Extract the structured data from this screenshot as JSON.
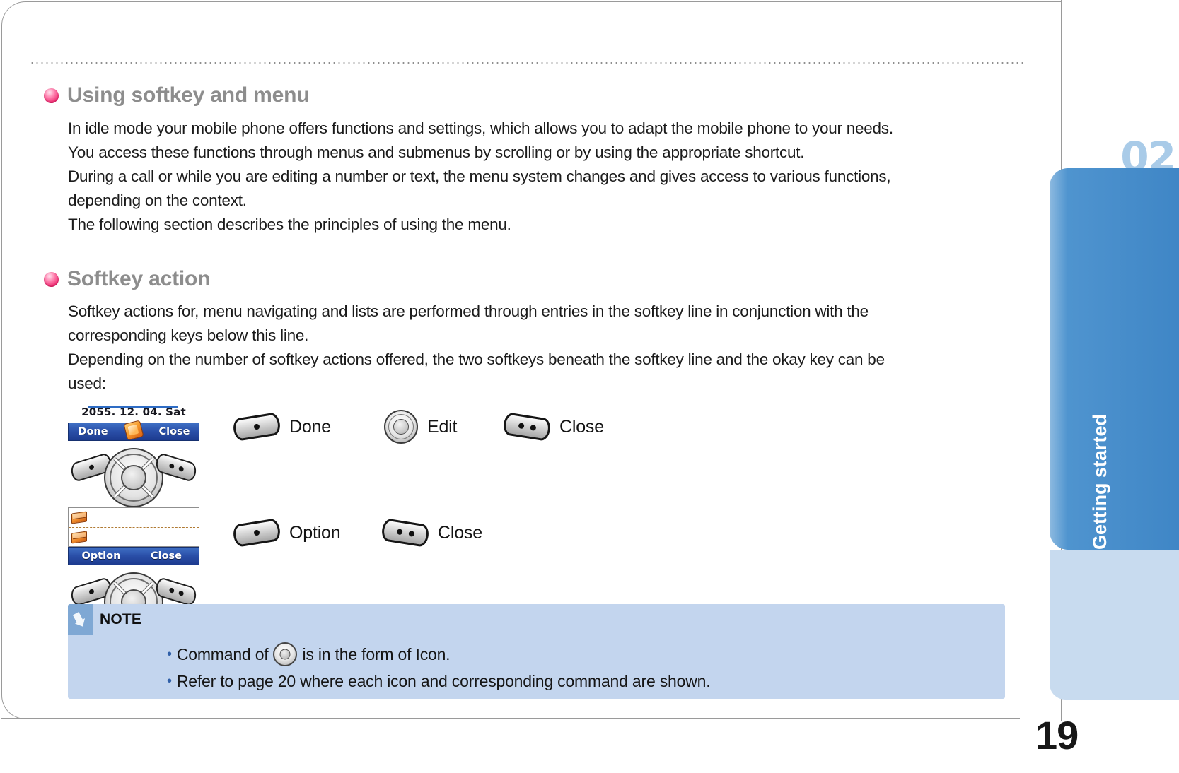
{
  "sections": [
    {
      "heading": "Using softkey and menu",
      "paragraphs": [
        "In idle mode your mobile phone offers functions and settings, which allows you to adapt the mobile phone to your needs.",
        "You access these functions through menus and submenus by scrolling or by using the appropriate shortcut.",
        "During a call or while you are editing a number or text, the menu system changes and gives access to various functions,",
        "depending on the context.",
        "The following section describes the principles of using the menu."
      ]
    },
    {
      "heading": "Softkey action",
      "paragraphs": [
        "Softkey actions for, menu navigating and lists are performed through entries in the softkey line in conjunction with the",
        "corresponding keys below this line.",
        "Depending on the number of softkey actions offered, the two softkeys beneath the softkey line and the okay key can be",
        "used:"
      ]
    }
  ],
  "mockups": [
    {
      "name": "idle-screen-mockup",
      "date_text": "2055. 12. 04. Sat",
      "softkey_left": "Done",
      "softkey_center_icon": "pencil-icon",
      "softkey_right": "Close"
    },
    {
      "name": "list-screen-mockup",
      "list_icons": [
        "envelope-icon",
        "envelope-icon"
      ],
      "softkey_left": "Option",
      "softkey_right": "Close"
    }
  ],
  "legend_row_1": [
    {
      "key_icon": "left-softkey-icon",
      "label": "Done"
    },
    {
      "key_icon": "okay-key-icon",
      "label": "Edit"
    },
    {
      "key_icon": "right-softkey-icon",
      "label": "Close"
    }
  ],
  "legend_row_2": [
    {
      "key_icon": "left-softkey-icon",
      "label": "Option"
    },
    {
      "key_icon": "right-softkey-icon",
      "label": "Close"
    }
  ],
  "note": {
    "title": "NOTE",
    "icon": "note-arrow-icon",
    "line1_before": "Command of",
    "line1_icon": "okay-key-icon",
    "line1_after": "is in the form of Icon.",
    "line2": "Refer to page 20 where each icon and corresponding command are shown."
  },
  "chapter": {
    "number": "02",
    "label": "Getting started"
  },
  "page_number": "19",
  "colors": {
    "accent_pink": "#ef2f74",
    "heading_grey": "#8d8d8d",
    "tab_blue": "#3f86c6",
    "note_bg": "#c3d5ee",
    "softbar_blue": "#2a4fa8"
  }
}
